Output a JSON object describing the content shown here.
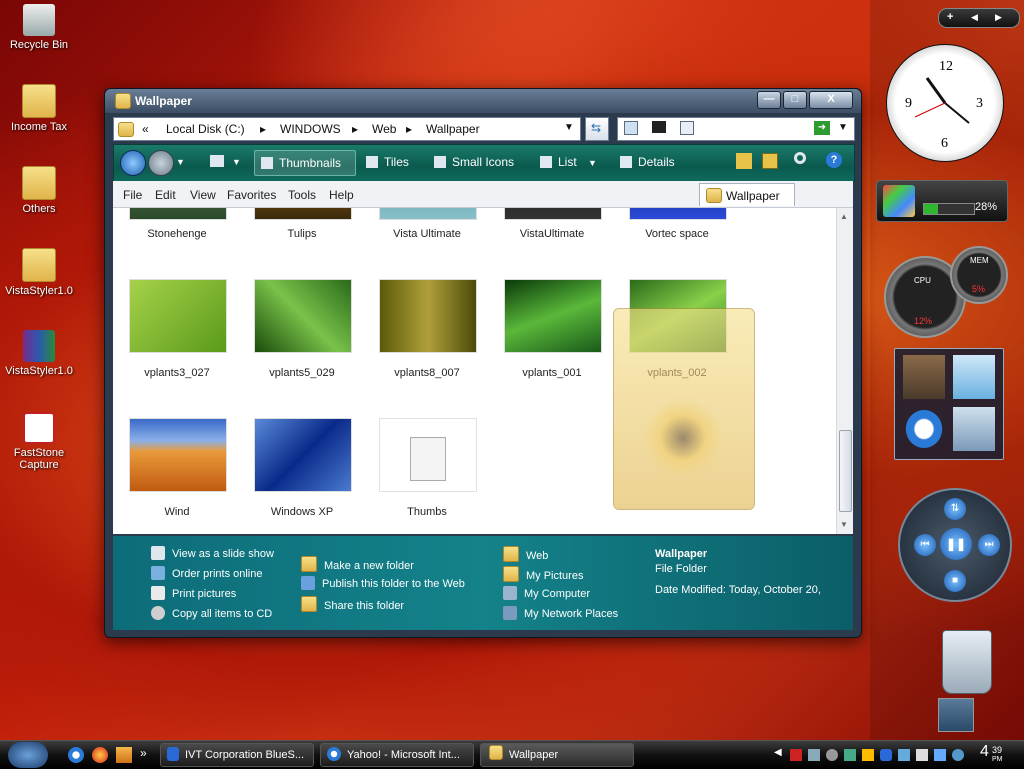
{
  "desktop": {
    "icons": [
      {
        "label": "Recycle Bin"
      },
      {
        "label": "Income Tax"
      },
      {
        "label": "Others"
      },
      {
        "label": "VistaStyler1.0"
      },
      {
        "label": "VistaStyler1.0"
      },
      {
        "label": "FastStone Capture"
      }
    ]
  },
  "window": {
    "title": "Wallpaper",
    "controls": {
      "minimize": "—",
      "maximize": "□",
      "close": "X"
    },
    "address": {
      "prefix": "«",
      "path": [
        "Local Disk (C:)",
        "WINDOWS",
        "Web",
        "Wallpaper"
      ]
    },
    "commandbar": {
      "thumbnails": "Thumbnails",
      "tiles": "Tiles",
      "small_icons": "Small Icons",
      "list": "List",
      "details": "Details"
    },
    "menu": [
      "File",
      "Edit",
      "View",
      "Favorites",
      "Tools",
      "Help"
    ],
    "folder_tab": "Wallpaper",
    "files_row1": [
      "Stonehenge",
      "Tulips",
      "Vista Ultimate",
      "VistaUltimate",
      "Vortec space"
    ],
    "files_row2": [
      "vplants3_027",
      "vplants5_029",
      "vplants8_007",
      "vplants_001",
      "vplants_002"
    ],
    "files_row3": [
      "Wind",
      "Windows XP",
      "Thumbs"
    ],
    "tasks": {
      "col1": [
        "View as a slide show",
        "Order prints online",
        "Print pictures",
        "Copy all items to CD"
      ],
      "col2": [
        "Make a new folder",
        "Publish this folder to the Web",
        "Share this folder"
      ],
      "col3": [
        "Web",
        "My Pictures",
        "My Computer",
        "My Network Places"
      ]
    },
    "details": {
      "name": "Wallpaper",
      "type": "File Folder",
      "modified": "Date Modified: Today, October 20,"
    }
  },
  "sidebar": {
    "meter": "28%",
    "gauges": {
      "cpu_label": "CPU",
      "cpu_value": "12%",
      "mem_label": "MEM",
      "mem_value": "5%"
    }
  },
  "taskbar": {
    "quicklaunch_more": "»",
    "buttons": [
      "IVT Corporation BlueS...",
      "Yahoo! - Microsoft Int...",
      "Wallpaper"
    ],
    "clock": "4",
    "clock_min": "39",
    "clock_ampm": "PM"
  },
  "colors": {
    "accent": "#0d6c79",
    "desktop": "#c3200a"
  }
}
